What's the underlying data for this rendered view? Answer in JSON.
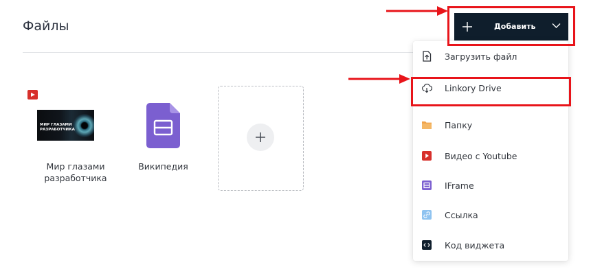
{
  "header": {
    "title": "Файлы"
  },
  "toolbar": {
    "add_label": "Добавить"
  },
  "files": [
    {
      "name": "Мир глазами разработчика",
      "type": "youtube",
      "thumbnail_text": "МИР ГЛАЗАМИ РАЗРАБОТЧИКА"
    },
    {
      "name": "Википедия",
      "type": "iframe"
    }
  ],
  "add_menu": {
    "items": [
      {
        "label": "Загрузить файл",
        "icon": "upload-file-icon"
      },
      {
        "label": "Linkory Drive",
        "icon": "cloud-download-icon"
      },
      {
        "label": "Папку",
        "icon": "folder-icon"
      },
      {
        "label": "Видео с Youtube",
        "icon": "youtube-icon"
      },
      {
        "label": "IFrame",
        "icon": "iframe-icon"
      },
      {
        "label": "Ссылка",
        "icon": "link-icon"
      },
      {
        "label": "Код виджета",
        "icon": "widget-code-icon"
      }
    ]
  },
  "colors": {
    "accent": "#0f1e2c",
    "annotation": "#e8141a",
    "folder": "#f0a24a",
    "youtube": "#d7302c",
    "iframe": "#7b5fd0",
    "link": "#8fc3f0"
  }
}
